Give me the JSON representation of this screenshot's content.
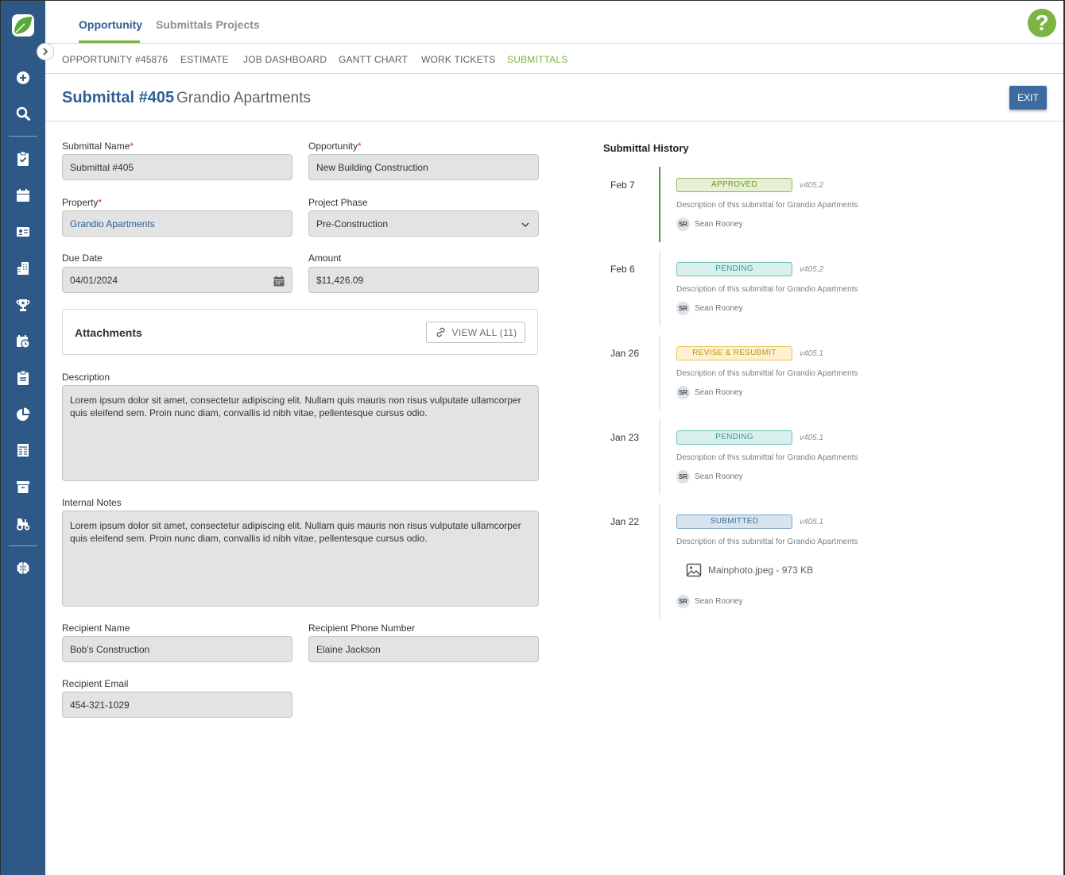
{
  "top_tabs": {
    "opportunity": "Opportunity",
    "submittals_projects": "Submittals Projects"
  },
  "help_label": "?",
  "subnav": [
    "OPPORTUNITY #45876",
    "ESTIMATE",
    "JOB DASHBOARD",
    "GANTT CHART",
    "WORK TICKETS",
    "SUBMITTALS"
  ],
  "subnav_active": "SUBMITTALS",
  "header": {
    "title": "Submittal #405",
    "subtitle": "Grandio Apartments",
    "exit_label": "EXIT"
  },
  "form": {
    "submittal_name": {
      "label": "Submittal Name",
      "required": "*",
      "value": "Submittal #405"
    },
    "opportunity": {
      "label": "Opportunity",
      "required": "*",
      "value": "New Building Construction"
    },
    "property": {
      "label": "Property",
      "required": "*",
      "value": "Grandio Apartments"
    },
    "project_phase": {
      "label": "Project Phase",
      "value": "Pre-Construction"
    },
    "due_date": {
      "label": "Due Date",
      "value": "04/01/2024"
    },
    "amount": {
      "label": "Amount",
      "value": "$11,426.09"
    },
    "attachments": {
      "title": "Attachments",
      "view_all": "VIEW ALL (11)"
    },
    "description": {
      "label": "Description",
      "value": "Lorem ipsum dolor sit amet, consectetur adipiscing elit. Nullam quis mauris non risus vulputate ullamcorper quis eleifend sem. Proin nunc diam, convallis id nibh vitae, pellentesque cursus odio."
    },
    "internal_notes": {
      "label": "Internal Notes",
      "value": "Lorem ipsum dolor sit amet, consectetur adipiscing elit. Nullam quis mauris non risus vulputate ullamcorper quis eleifend sem. Proin nunc diam, convallis id nibh vitae, pellentesque cursus odio."
    },
    "recipient_name": {
      "label": "Recipient Name",
      "value": "Bob's Construction"
    },
    "recipient_phone": {
      "label": "Recipient Phone Number",
      "value": "Elaine Jackson"
    },
    "recipient_email": {
      "label": "Recipient Email",
      "value": "454-321-1029"
    }
  },
  "history": {
    "title": "Submittal History",
    "entries": [
      {
        "date": "Feb 7",
        "status": "APPROVED",
        "version": "v405.2",
        "description": "Description of this submittal for Grandio Apartments",
        "initials": "SR",
        "user": "Sean Rooney"
      },
      {
        "date": "Feb 6",
        "status": "PENDING",
        "version": "v405.2",
        "description": "Description of this submittal for Grandio Apartments",
        "initials": "SR",
        "user": "Sean Rooney"
      },
      {
        "date": "Jan 26",
        "status": "REVISE & RESUBMIT",
        "version": "v405.1",
        "description": "Description of this submittal for Grandio Apartments",
        "initials": "SR",
        "user": "Sean Rooney"
      },
      {
        "date": "Jan 23",
        "status": "PENDING",
        "version": "v405.1",
        "description": "Description of this submittal for Grandio Apartments",
        "initials": "SR",
        "user": "Sean Rooney"
      },
      {
        "date": "Jan 22",
        "status": "SUBMITTED",
        "version": "v405.1",
        "description": "Description of this submittal for Grandio Apartments",
        "file": "Mainphoto.jpeg - 973 KB",
        "initials": "SR",
        "user": "Sean Rooney"
      }
    ]
  },
  "colors": {
    "sidebar": "#2e5986",
    "accent_green": "#7cb342",
    "brand_blue": "#2e6096"
  },
  "sidebar_icons": [
    "logo-icon",
    "add-icon",
    "search-icon",
    "clipboard-check-icon",
    "calendar-icon",
    "contact-card-icon",
    "buildings-icon",
    "trophy-icon",
    "calendar-clock-icon",
    "clipboard-icon",
    "pie-chart-icon",
    "invoice-icon",
    "archive-icon",
    "tractor-icon",
    "brain-icon"
  ]
}
